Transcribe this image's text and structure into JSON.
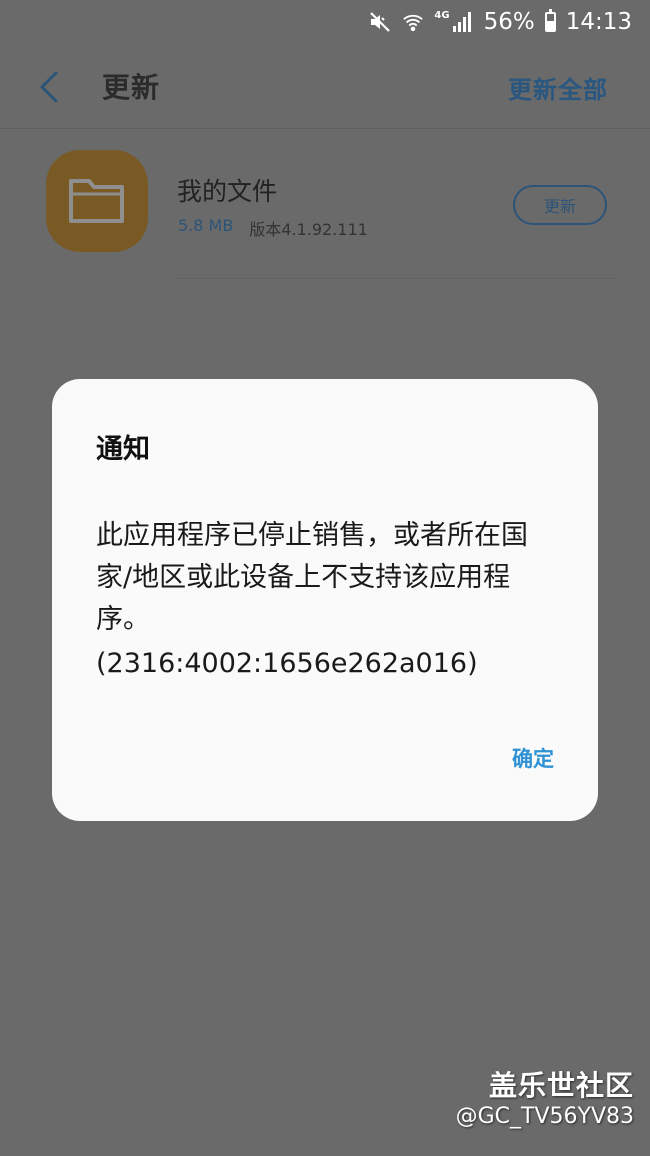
{
  "status_bar": {
    "network_label": "4G",
    "battery": "56%",
    "battery_level": 0.56,
    "time": "14:13",
    "icons": [
      "mute-icon",
      "wifi-icon",
      "signal-icon",
      "battery-icon"
    ]
  },
  "app_bar": {
    "title": "更新",
    "update_all_label": "更新全部",
    "back_icon": "chevron-left-icon"
  },
  "app_item": {
    "name": "我的文件",
    "size": "5.8 MB",
    "version": "版本4.1.92.111",
    "update_label": "更新",
    "icon": "folder-icon",
    "icon_color": "#7a5a24"
  },
  "dialog": {
    "title": "通知",
    "message": "此应用程序已停止销售，或者所在国家/地区或此设备上不支持该应用程序。",
    "code": "(2316:4002:1656e262a016)",
    "confirm_label": "确定"
  },
  "watermark": {
    "logo": "盖乐世社区",
    "user": "@GC_TV56YV83"
  },
  "colors": {
    "accent": "#2e92d4",
    "dimmed_accent": "#2c5478",
    "scrim_background": "#6a6a6a",
    "dialog_background": "#fafafa"
  }
}
